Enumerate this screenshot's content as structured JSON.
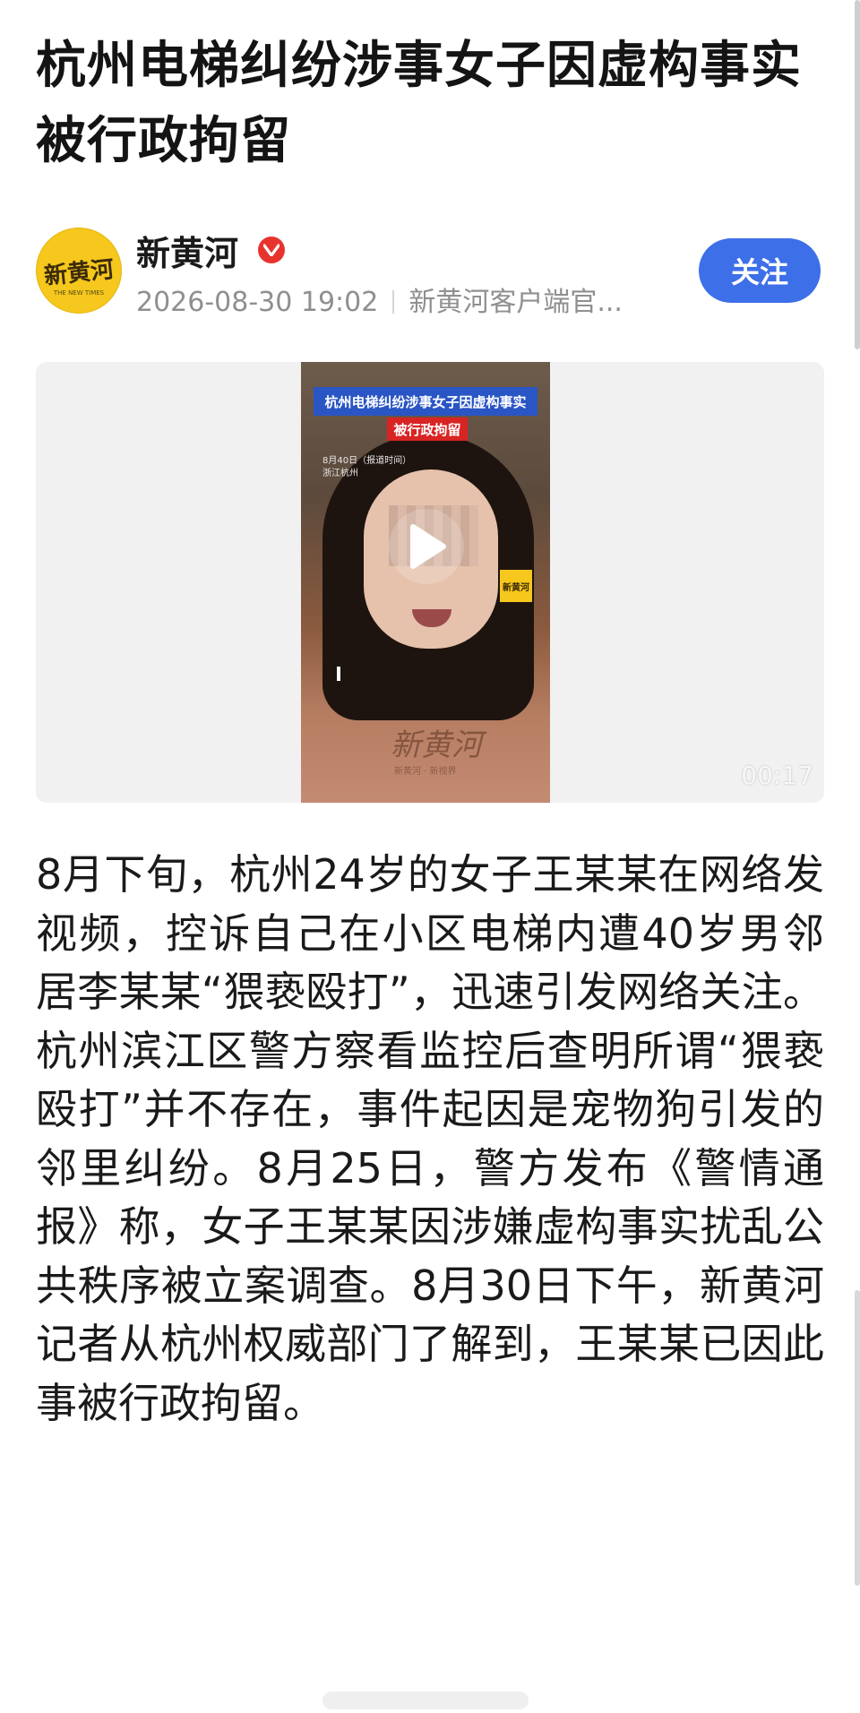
{
  "article": {
    "title": "杭州电梯纠纷涉事女子因虚构事实被行政拘留",
    "body": "8月下旬，杭州24岁的女子王某某在网络发视频，控诉自己在小区电梯内遭40岁男邻居李某某“猥亵殴打”，迅速引发网络关注。杭州滨江区警方察看监控后查明所谓“猥亵殴打”并不存在，事件起因是宠物狗引发的邻里纠纷。8月25日，警方发布《警情通报》称，女子王某某因涉嫌虚构事实扰乱公共秩序被立案调查。8月30日下午，新黄河记者从杭州权威部门了解到，王某某已因此事被行政拘留。"
  },
  "author": {
    "name": "新黄河",
    "avatar_text": "新黄河",
    "avatar_subtext": "THE NEW TIMES",
    "timestamp": "2026-08-30 19:02",
    "source": "新黄河客户端官...",
    "follow_label": "关注",
    "verified_icon": "verified-icon",
    "verified_color": "#e8332d"
  },
  "video": {
    "banner_line1": "杭州电梯纠纷涉事女子因虚构事实",
    "banner_line2": "被行政拘留",
    "caption": "8月40日（报道时间）\n浙江杭州",
    "mini_logo": "新黄河",
    "watermark": "新黄河",
    "watermark_sub": "新黄河 · 新视界",
    "duration": "00:17",
    "play_icon": "play-icon"
  },
  "colors": {
    "follow_button": "#3d6fe8",
    "title_text": "#141414",
    "meta_text": "#8f8f8f"
  }
}
